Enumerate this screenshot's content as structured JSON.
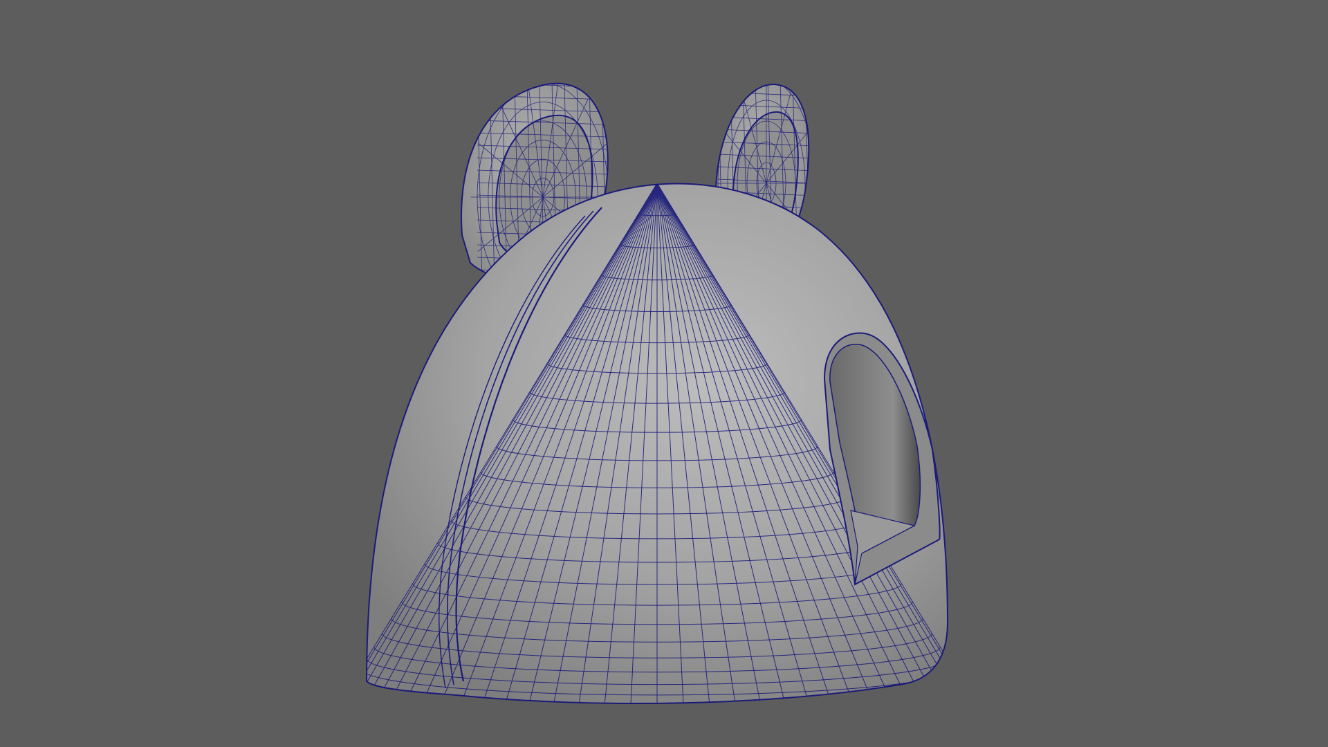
{
  "viewport": {
    "background_color": "#5d5d5d",
    "shading_mode": "smooth-shaded-with-wireframe",
    "wire_color": "#1a1a7a",
    "surface_color": "#9c9c9c"
  },
  "scene": {
    "objects": [
      {
        "name": "dome-house",
        "parts": [
          "dome-body",
          "left-ear",
          "right-ear",
          "arched-doorway"
        ]
      }
    ]
  }
}
